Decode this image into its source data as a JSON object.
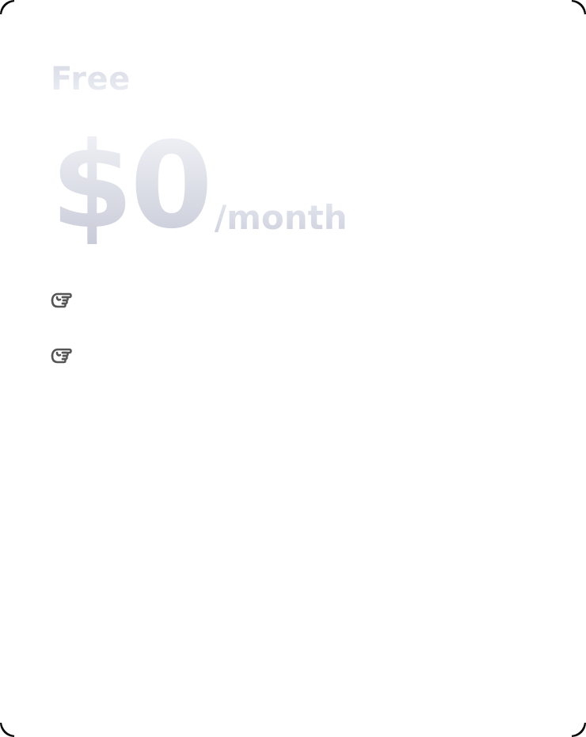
{
  "plan": {
    "name": "Free",
    "price": "$0",
    "period": "/month"
  },
  "features": [
    {
      "icon": "pointing-hand-icon",
      "text": ""
    },
    {
      "icon": "pointing-hand-icon",
      "text": ""
    }
  ],
  "colors": {
    "background": "#ffffff",
    "text_light": "#d4d7e2",
    "icon_stroke": "#555555"
  }
}
